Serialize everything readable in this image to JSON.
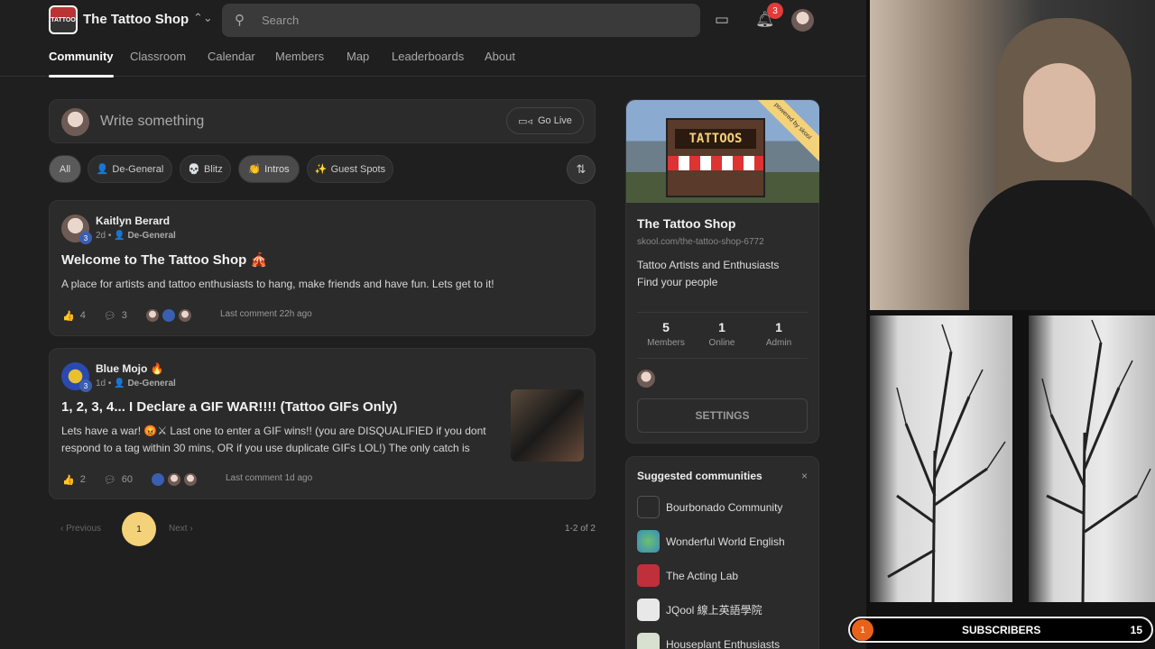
{
  "header": {
    "brand": "The Tattoo Shop",
    "logo_text": "TATTOO",
    "search_placeholder": "Search",
    "notification_count": "3"
  },
  "tabs": [
    "Community",
    "Classroom",
    "Calendar",
    "Members",
    "Map",
    "Leaderboards",
    "About"
  ],
  "composer": {
    "placeholder": "Write something",
    "go_live": "Go Live"
  },
  "filters": [
    {
      "emoji": "",
      "label": "All"
    },
    {
      "emoji": "👤",
      "label": "De-General"
    },
    {
      "emoji": "💀",
      "label": "Blitz"
    },
    {
      "emoji": "👏",
      "label": "Intros"
    },
    {
      "emoji": "✨",
      "label": "Guest Spots"
    }
  ],
  "posts": [
    {
      "author": "Kaitlyn Berard",
      "level": "3",
      "age": "2d",
      "sep": "•",
      "category": "De-General",
      "title": "Welcome to The Tattoo Shop 🎪",
      "body": "A place for artists and tattoo enthusiasts to hang, make friends and have fun. Lets get to it!",
      "likes": "4",
      "comments": "3",
      "last_comment": "Last comment 22h ago"
    },
    {
      "author": "Blue Mojo 🔥",
      "level": "3",
      "age": "1d",
      "sep": "•",
      "category": "De-General",
      "title": "1, 2, 3, 4... I Declare a GIF WAR!!!! (Tattoo GIFs Only)",
      "body": "Lets have a war! 😡⚔ Last one to enter a GIF wins!! (you are DISQUALIFIED if you dont respond to a tag within 30 mins, OR if you use duplicate GIFs LOL!) The only catch is",
      "likes": "2",
      "comments": "60",
      "last_comment": "Last comment 1d ago"
    }
  ],
  "pagination": {
    "prev": "Previous",
    "page": "1",
    "next": "Next",
    "count": "1-2 of 2"
  },
  "community": {
    "banner_sign": "TATTOOS",
    "ribbon": "powered by skool",
    "name": "The Tattoo Shop",
    "url": "skool.com/the-tattoo-shop-6772",
    "desc1": "Tattoo Artists and Enthusiasts",
    "desc2": "Find your people",
    "stats": [
      {
        "n": "5",
        "l": "Members"
      },
      {
        "n": "1",
        "l": "Online"
      },
      {
        "n": "1",
        "l": "Admin"
      }
    ],
    "settings": "SETTINGS"
  },
  "suggested": {
    "heading": "Suggested communities",
    "close": "×",
    "items": [
      {
        "name": "Bourbonado Community",
        "color": "#2a2a2a"
      },
      {
        "name": "Wonderful World English",
        "color": "#3a8ac0"
      },
      {
        "name": "The Acting Lab",
        "color": "#c0303a"
      },
      {
        "name": "JQool 線上英語學院",
        "color": "#e8e8e8"
      },
      {
        "name": "Houseplant Enthusiasts",
        "color": "#d8e0d0"
      }
    ]
  },
  "stream": {
    "subscribers_label": "SUBSCRIBERS",
    "subscribers_count": "15",
    "circle": "1"
  }
}
